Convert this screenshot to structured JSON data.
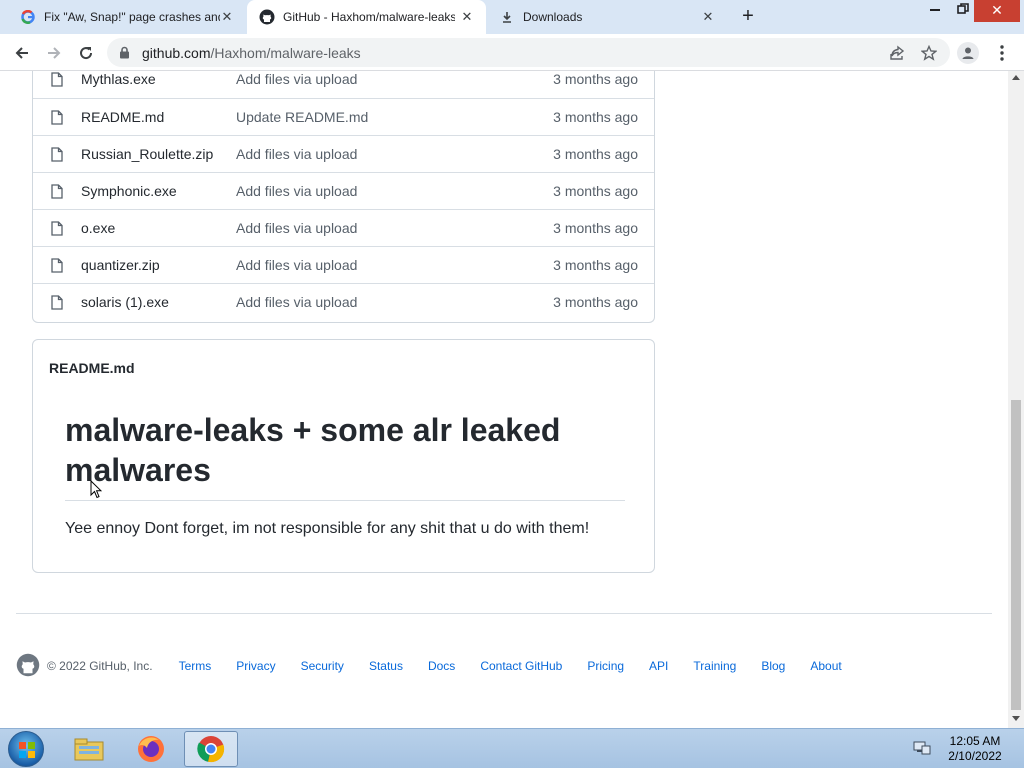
{
  "tabs": [
    {
      "title": "Fix \"Aw, Snap!\" page crashes and",
      "favicon": "google-icon"
    },
    {
      "title": "GitHub - Haxhom/malware-leaks",
      "favicon": "github-icon"
    },
    {
      "title": "Downloads",
      "favicon": "download-icon"
    }
  ],
  "address": {
    "host": "github.com",
    "path": "/Haxhom/malware-leaks"
  },
  "files": [
    {
      "name": "Mythlas.exe",
      "message": "Add files via upload",
      "age": "3 months ago"
    },
    {
      "name": "README.md",
      "message": "Update README.md",
      "age": "3 months ago"
    },
    {
      "name": "Russian_Roulette.zip",
      "message": "Add files via upload",
      "age": "3 months ago"
    },
    {
      "name": "Symphonic.exe",
      "message": "Add files via upload",
      "age": "3 months ago"
    },
    {
      "name": "o.exe",
      "message": "Add files via upload",
      "age": "3 months ago"
    },
    {
      "name": "quantizer.zip",
      "message": "Add files via upload",
      "age": "3 months ago"
    },
    {
      "name": "solaris (1).exe",
      "message": "Add files via upload",
      "age": "3 months ago"
    }
  ],
  "readme": {
    "filename": "README.md",
    "heading": "malware-leaks + some alr leaked malwares",
    "body": "Yee ennoy Dont forget, im not responsible for any shit that u do with them!"
  },
  "footer": {
    "copyright": "© 2022 GitHub, Inc.",
    "links": [
      "Terms",
      "Privacy",
      "Security",
      "Status",
      "Docs",
      "Contact GitHub",
      "Pricing",
      "API",
      "Training",
      "Blog",
      "About"
    ]
  },
  "clock": {
    "time": "12:05 AM",
    "date": "2/10/2022"
  },
  "colors": {
    "link": "#0969da",
    "tabstrip": "#d9e6f5",
    "text": "#24292f"
  }
}
